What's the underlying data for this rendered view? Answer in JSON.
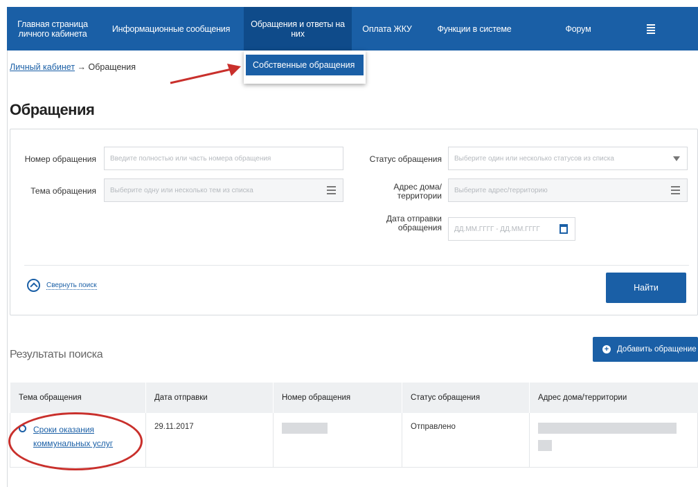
{
  "nav": {
    "items": [
      "Главная страница личного кабинета",
      "Информационные сообщения",
      "Обращения и ответы на них",
      "Оплата ЖКУ",
      "Функции в системе",
      "Форум"
    ]
  },
  "dropdown": {
    "item": "Собственные обращения"
  },
  "breadcrumb": {
    "link": "Личный кабинет",
    "separator": "→",
    "current": "Обращения"
  },
  "page_title": "Обращения",
  "search": {
    "number_label": "Номер обращения",
    "number_placeholder": "Введите полностью или часть номера обращения",
    "subject_label": "Тема обращения",
    "subject_placeholder": "Выберите одну или несколько тем из списка",
    "status_label": "Статус обращения",
    "status_placeholder": "Выберите один или несколько статусов из списка",
    "address_label": "Адрес дома/ территории",
    "address_placeholder": "Выберите адрес/территорию",
    "date_label": "Дата отправки обращения",
    "date_placeholder": "ДД.ММ.ГГГГ - ДД.ММ.ГГГГ",
    "collapse": "Свернуть поиск",
    "find_button": "Найти"
  },
  "results": {
    "title": "Результаты поиска",
    "add_button": "Добавить обращение",
    "columns": [
      "Тема обращения",
      "Дата отправки",
      "Номер обращения",
      "Статус обращения",
      "Адрес дома/территории"
    ],
    "rows": [
      {
        "subject": "Сроки оказания коммунальных услуг",
        "date": "29.11.2017",
        "status": "Отправлено"
      }
    ]
  },
  "colors": {
    "brand": "#1a5fa6",
    "annotation": "#c9302c"
  },
  "icons": [
    "menu-icon",
    "chevron-up-icon",
    "plus-icon",
    "calendar-icon",
    "list-icon",
    "dropdown-arrow-icon",
    "message-icon"
  ]
}
